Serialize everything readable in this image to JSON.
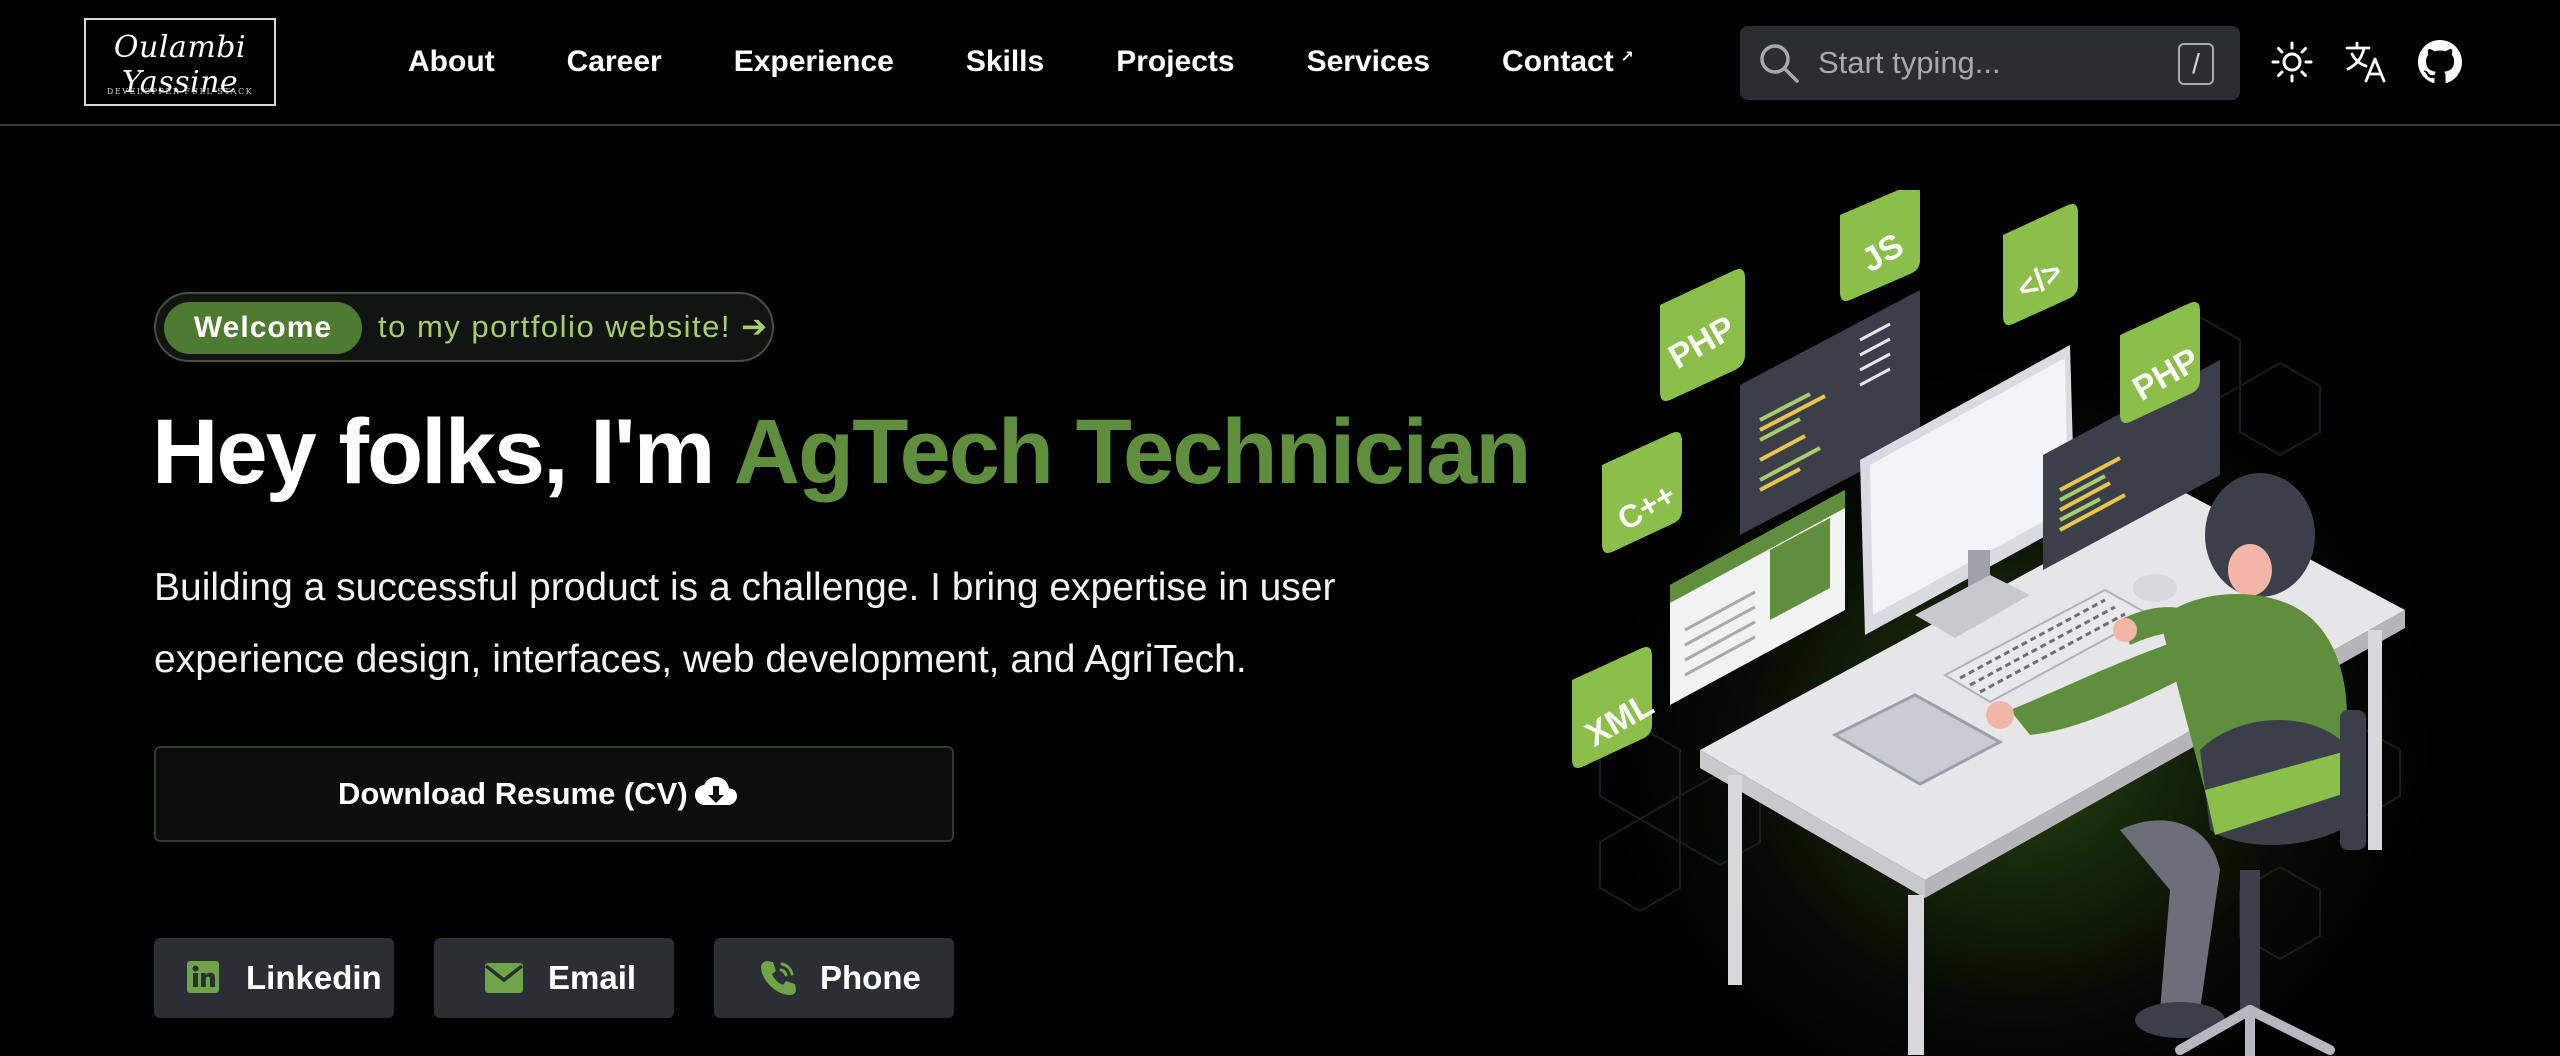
{
  "logo": {
    "script": "Oulambi Yassine",
    "subtitle": "DEVELOPPER FULL STACK"
  },
  "nav": {
    "links": [
      "About",
      "Career",
      "Experience",
      "Skills",
      "Projects",
      "Services",
      "Contact"
    ],
    "contact_external_glyph": "↗"
  },
  "search": {
    "placeholder": "Start typing...",
    "shortcut": "/"
  },
  "header_icons": [
    "sun-icon",
    "translate-icon",
    "github-icon"
  ],
  "hero": {
    "welcome_pill": "Welcome",
    "welcome_rest": "to my portfolio website! ➔",
    "headline_prefix": "Hey folks, I'm",
    "headline_highlight": "AgTech Technician",
    "description": "Building a successful product is a challenge. I bring expertise in user experience design, interfaces, web development, and AgriTech.",
    "cv_button": "Download Resume (CV)",
    "socials": [
      {
        "label": "Linkedin",
        "icon": "linkedin-icon"
      },
      {
        "label": "Email",
        "icon": "email-icon"
      },
      {
        "label": "Phone",
        "icon": "phone-icon"
      }
    ],
    "illustration_tags": [
      "PHP",
      "JS",
      "</>",
      "PHP",
      "C++",
      "XML"
    ]
  },
  "colors": {
    "accent_green": "#5f8f3c",
    "light_green": "#a6cd6b",
    "pill_green": "#4f7a32",
    "button_gray": "#2b2f33"
  }
}
